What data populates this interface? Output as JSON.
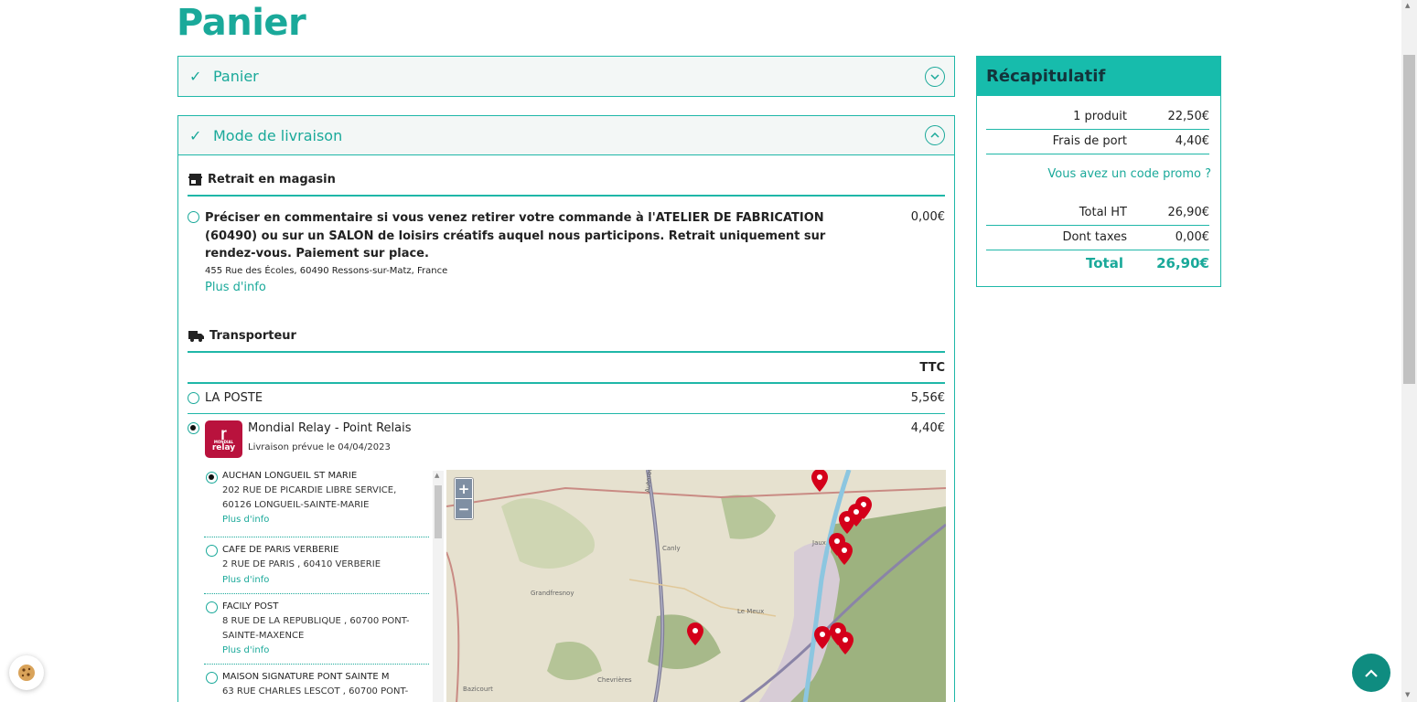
{
  "page": {
    "title": "Panier"
  },
  "accordion": {
    "panier": {
      "label": "Panier"
    },
    "livraison": {
      "label": "Mode de livraison"
    }
  },
  "store_pickup": {
    "title": "Retrait en magasin",
    "description": "Préciser en commentaire si vous venez retirer votre commande à l'ATELIER DE FABRICATION (60490) ou sur un SALON de loisirs créatifs auquel nous participons. Retrait uniquement sur rendez-vous. Paiement sur place.",
    "address": "455 Rue des Écoles, 60490 Ressons-sur-Matz, France",
    "info_link": "Plus d'info",
    "price": "0,00€"
  },
  "carriers": {
    "title": "Transporteur",
    "header_ttc": "TTC",
    "la_poste": {
      "name": "LA POSTE",
      "price": "5,56€"
    },
    "mondial": {
      "name": "Mondial Relay - Point Relais",
      "delivery": "Livraison prévue le 04/04/2023",
      "price": "4,40€",
      "logo_top": "MONDIAL",
      "logo_bottom": "relay"
    }
  },
  "relays": [
    {
      "name": "AUCHAN LONGUEIL ST MARIE",
      "addr1": "202 RUE DE PICARDIE LIBRE SERVICE,",
      "addr2": "60126 LONGUEIL-SAINTE-MARIE",
      "link": "Plus d'info"
    },
    {
      "name": "CAFE DE PARIS VERBERIE",
      "addr1": "2 RUE DE PARIS , 60410 VERBERIE",
      "addr2": "",
      "link": "Plus d'info"
    },
    {
      "name": "FACILY POST",
      "addr1": "8 RUE DE LA REPUBLIQUE , 60700 PONT-",
      "addr2": "SAINTE-MAXENCE",
      "link": "Plus d'info"
    },
    {
      "name": "MAISON SIGNATURE PONT SAINTE M",
      "addr1": "63 RUE CHARLES LESCOT , 60700 PONT-",
      "addr2": "",
      "link": ""
    }
  ],
  "map": {
    "zoom_in": "+",
    "zoom_out": "−",
    "labels": [
      "Grandfresnoy",
      "Canly",
      "Le Meux",
      "Chevrières",
      "Bazicourt",
      "Autoroute",
      "Jaux"
    ]
  },
  "recap": {
    "title": "Récapitulatif",
    "products_label": "1 produit",
    "products_value": "22,50€",
    "shipping_label": "Frais de port",
    "shipping_value": "4,40€",
    "promo_link": "Vous avez un code promo ?",
    "total_ht_label": "Total HT",
    "total_ht_value": "26,90€",
    "taxes_label": "Dont taxes",
    "taxes_value": "0,00€",
    "total_label": "Total",
    "total_value": "26,90€"
  },
  "colors": {
    "accent": "#1aa99a",
    "header": "#17bcac",
    "marker": "#d4001a",
    "mondial": "#b9123d"
  }
}
